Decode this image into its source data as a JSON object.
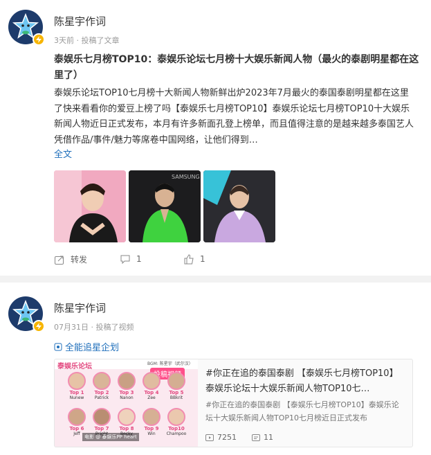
{
  "post1": {
    "author": "陈星宇作词",
    "meta": "3天前 · 投稿了文章",
    "title": "泰娱乐七月榜TOP10：泰娱乐论坛七月榜十大娱乐新闻人物（最火的泰剧明星都在这里了）",
    "body": "泰娱乐论坛TOP10七月榜十大新闻人物新鲜出炉2023年7月最火的泰国泰剧明星都在这里了快来看看你的爱豆上榜了吗【泰娱乐七月榜TOP10】泰娱乐论坛七月榜TOP10十大娱乐新闻人物近日正式发布，本月有许多新面孔登上榜单，而且值得注意的是越来越多泰国艺人凭借作品/事件/魅力等席卷中国网络，让他们得到…",
    "more": "全文",
    "image_text": "SAMSUNG",
    "actions": {
      "repost": "转发",
      "comments": "1",
      "likes": "1"
    }
  },
  "post2": {
    "author": "陈星宇作词",
    "meta": "07月31日 · 投稿了视频",
    "tag": "全能追星企划",
    "video": {
      "thumb_header": "泰娱乐论坛",
      "thumb_badge": "投稿视频",
      "thumb_bgm": "BGM: 陈星宇（武尔汉）",
      "thumb_watermark": "电影 @ 泰娱乐PP heart",
      "top": [
        {
          "rank": "Top 1",
          "name": "Nunew"
        },
        {
          "rank": "Top 2",
          "name": "Patrick"
        },
        {
          "rank": "Top 3",
          "name": "Nanon"
        },
        {
          "rank": "Top 4",
          "name": "Zee"
        },
        {
          "rank": "Top 5",
          "name": "BBkrit"
        },
        {
          "rank": "Top 6",
          "name": "Jeff"
        },
        {
          "rank": "Top 7",
          "name": "Bright"
        },
        {
          "rank": "Top 8",
          "name": "Becky"
        },
        {
          "rank": "Top 9",
          "name": "Win"
        },
        {
          "rank": "Top10",
          "name": "Champoo"
        }
      ],
      "title": "#你正在追的泰国泰剧 【泰娱乐七月榜TOP10】泰娱乐论坛十大娱乐新闻人物TOP10七…",
      "desc": "#你正在追的泰国泰剧 【泰娱乐七月榜TOP10】泰娱乐论坛十大娱乐新闻人物TOP10七月榜近日正式发布",
      "plays": "7251",
      "danmaku": "11"
    }
  },
  "colors": {
    "link": "#1f6fbb",
    "badge": "#f7b500",
    "avatar_bg": "#1d3b6b"
  }
}
